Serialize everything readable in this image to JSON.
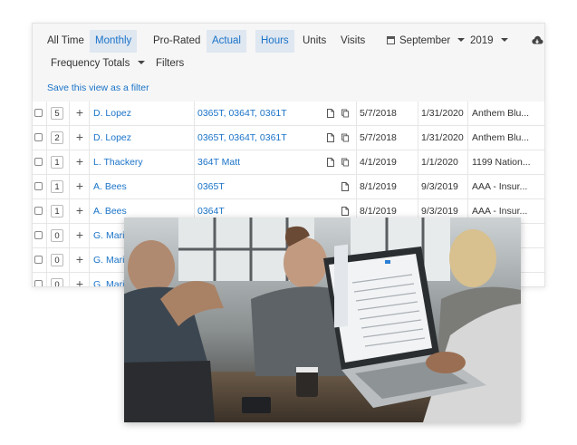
{
  "toolbar": {
    "all_time": "All Time",
    "monthly": "Monthly",
    "pro_rated": "Pro-Rated",
    "actual": "Actual",
    "hours": "Hours",
    "units": "Units",
    "visits": "Visits",
    "month": "September",
    "year": "2019",
    "frequency_totals": "Frequency Totals",
    "filters": "Filters",
    "save_filter": "Save this view as a filter"
  },
  "rows": [
    {
      "count": "5",
      "name": "D. Lopez",
      "codes": "0365T, 0364T, 0361T",
      "start": "5/7/2018",
      "end": "1/31/2020",
      "payer": "Anthem Blu...",
      "copy": true
    },
    {
      "count": "2",
      "name": "D. Lopez",
      "codes": "0365T, 0364T, 0361T",
      "start": "5/7/2018",
      "end": "1/31/2020",
      "payer": "Anthem Blu...",
      "copy": true
    },
    {
      "count": "1",
      "name": "L. Thackery",
      "codes": "364T Matt",
      "start": "4/1/2019",
      "end": "1/1/2020",
      "payer": "1199 Nation...",
      "copy": true
    },
    {
      "count": "1",
      "name": "A. Bees",
      "codes": "0365T",
      "start": "8/1/2019",
      "end": "9/3/2019",
      "payer": "AAA - Insur...",
      "copy": false
    },
    {
      "count": "1",
      "name": "A. Bees",
      "codes": "0364T",
      "start": "8/1/2019",
      "end": "9/3/2019",
      "payer": "AAA - Insur...",
      "copy": false
    },
    {
      "count": "0",
      "name": "G. Maria",
      "codes": "",
      "start": "",
      "end": "",
      "payer": "",
      "copy": false
    },
    {
      "count": "0",
      "name": "G. Maria",
      "codes": "",
      "start": "",
      "end": "",
      "payer": "",
      "copy": false
    },
    {
      "count": "0",
      "name": "G. Maria",
      "codes": "",
      "start": "",
      "end": "",
      "payer": "",
      "copy": false
    }
  ],
  "colors": {
    "accent": "#1a73c8",
    "active_bg": "#dfe7f1",
    "panel_bg": "#f6f6f6"
  },
  "icons": [
    "calendar-icon",
    "cloud-download-icon",
    "document-icon",
    "copy-icon",
    "plus-icon"
  ]
}
